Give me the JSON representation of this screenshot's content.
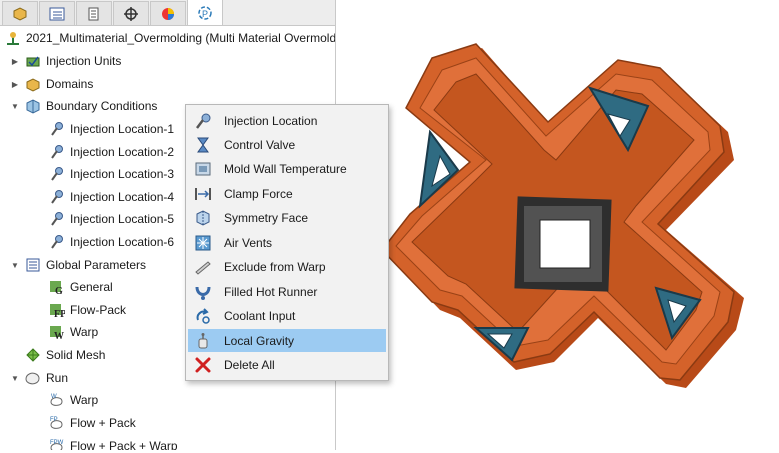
{
  "tabs": [
    {
      "name": "feature-manager"
    },
    {
      "name": "property-manager"
    },
    {
      "name": "configuration-manager"
    },
    {
      "name": "dimxpert-manager"
    },
    {
      "name": "display-manager"
    },
    {
      "name": "plastics-manager"
    }
  ],
  "tree": {
    "root": "2021_Multimaterial_Overmolding (Multi Material Overmolding",
    "injection_units": "Injection Units",
    "domains": "Domains",
    "boundary_conditions": "Boundary Conditions",
    "injection_locations": [
      "Injection Location-1",
      "Injection Location-2",
      "Injection Location-3",
      "Injection Location-4",
      "Injection Location-5",
      "Injection Location-6"
    ],
    "global_parameters": "Global Parameters",
    "gp_items": [
      "General",
      "Flow-Pack",
      "Warp"
    ],
    "solid_mesh": "Solid Mesh",
    "run": "Run",
    "run_items": [
      "Warp",
      "Flow + Pack",
      "Flow + Pack + Warp"
    ]
  },
  "context_menu": {
    "items": [
      {
        "label": "Injection Location"
      },
      {
        "label": "Control Valve"
      },
      {
        "label": "Mold Wall Temperature"
      },
      {
        "label": "Clamp Force"
      },
      {
        "label": "Symmetry Face"
      },
      {
        "label": "Air Vents"
      },
      {
        "label": "Exclude from Warp"
      },
      {
        "label": "Filled Hot Runner"
      },
      {
        "label": "Coolant Input"
      },
      {
        "label": "Local Gravity",
        "highlighted": true
      },
      {
        "label": "Delete All"
      }
    ]
  },
  "colors": {
    "part_orange": "#d4622a",
    "part_blue": "#2f6b82",
    "part_dark": "#3b3b3b",
    "highlight": "#9ccbf2"
  }
}
